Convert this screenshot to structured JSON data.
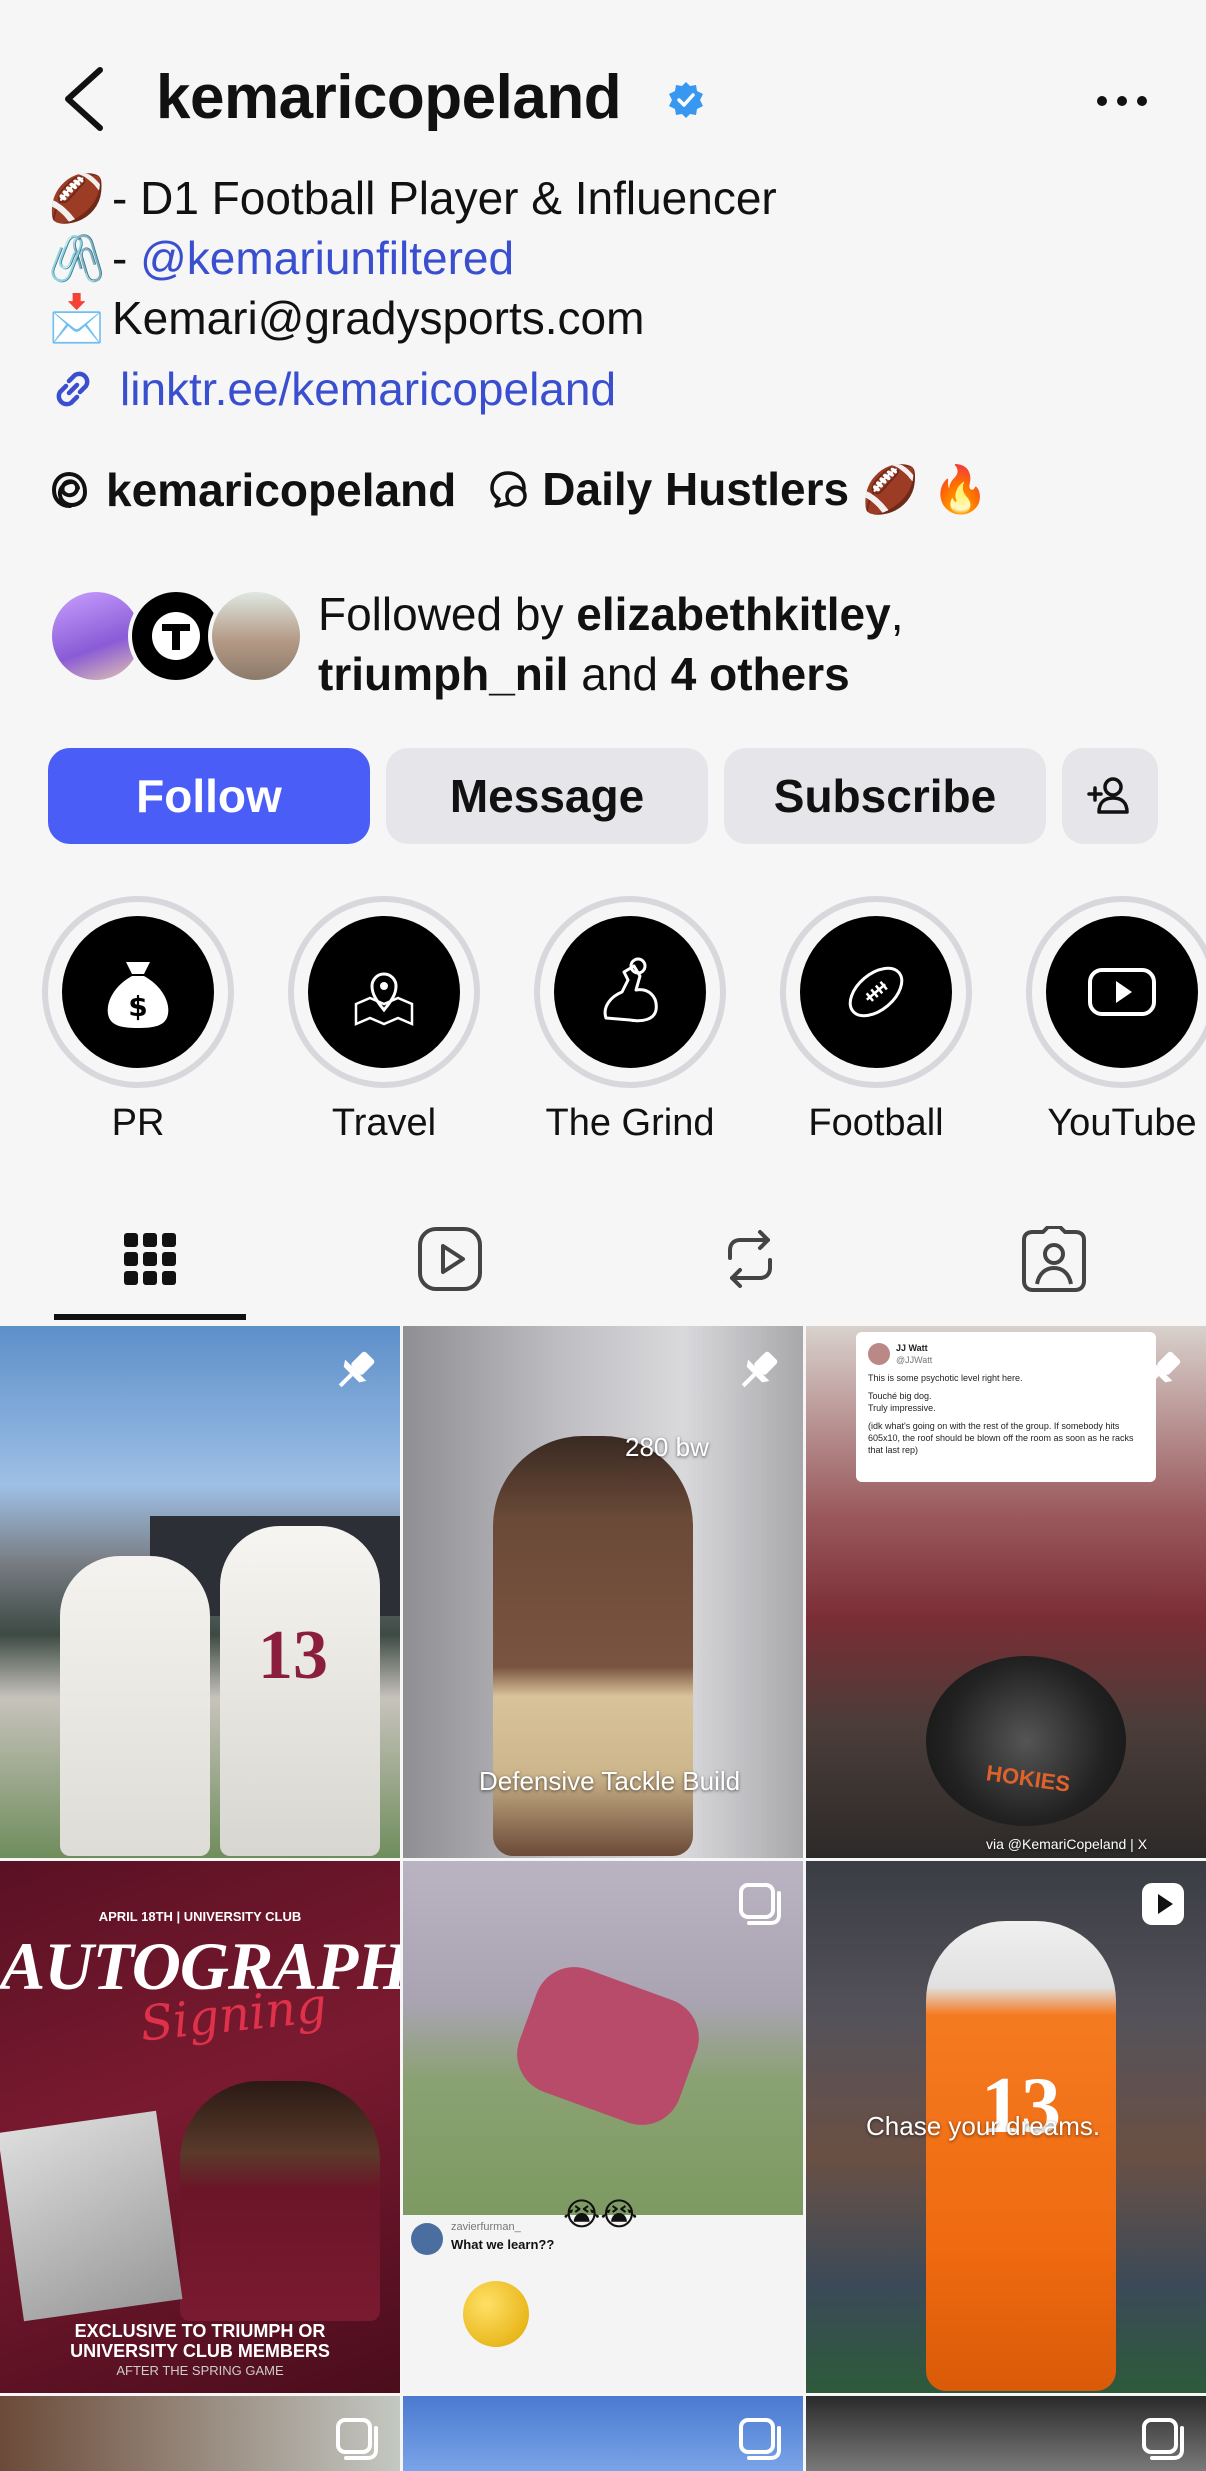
{
  "header": {
    "username": "kemaricopeland",
    "verified_color": "#3897f0"
  },
  "bio": {
    "line1_emoji": "🏈",
    "line1_text": "- D1 Football Player & Influencer",
    "line2_emoji": "🖇️",
    "line2_prefix": "-",
    "line2_mention": "@kemariunfiltered",
    "line3_emoji": "📩",
    "line3_text": "Kemari@gradysports.com",
    "link": "linktr.ee/kemaricopeland"
  },
  "threads": {
    "handle": "kemaricopeland",
    "channel": "Daily Hustlers 🏈 🔥"
  },
  "followed_by": {
    "prefix": "Followed by",
    "user1": "elizabethkitley",
    "separator": ",",
    "user2": "triumph_nil",
    "and": "and",
    "others": "4 others"
  },
  "buttons": {
    "follow": "Follow",
    "message": "Message",
    "subscribe": "Subscribe"
  },
  "highlights": [
    {
      "label": "PR",
      "icon": "money-bag-icon"
    },
    {
      "label": "Travel",
      "icon": "map-pin-icon"
    },
    {
      "label": "The Grind",
      "icon": "flexed-arm-icon"
    },
    {
      "label": "Football",
      "icon": "football-icon"
    },
    {
      "label": "YouTube",
      "icon": "play-icon"
    }
  ],
  "tabs": [
    "grid-icon",
    "reels-icon",
    "reposts-icon",
    "tagged-icon"
  ],
  "posts": [
    {
      "caption": "",
      "pinned": true
    },
    {
      "caption_top": "280 bw",
      "caption_bottom": "Defensive Tackle Build",
      "pinned": true
    },
    {
      "tweet_author": "JJ Watt",
      "tweet_handle": "@JJWatt",
      "tweet_text": "This is some psychotic level right here.",
      "tweet_text2": "Touché big dog.",
      "tweet_text3": "Truly impressive.",
      "tweet_text4": "(idk what's going on with the rest of the group. If somebody hits 605x10, the roof should be blown off the room as soon as he racks that last rep)",
      "credit": "via @KemariCopeland | X",
      "plate_text": "HOKIES",
      "pinned": true
    },
    {
      "top_line": "APRIL 18TH | UNIVERSITY CLUB",
      "title": "AUTOGRAPH",
      "subtitle": "Signing",
      "bottom1": "EXCLUSIVE TO TRIUMPH OR",
      "bottom2": "UNIVERSITY CLUB MEMBERS",
      "bottom3": "AFTER THE SPRING GAME"
    },
    {
      "comment_user": "zavierfurman_",
      "comment_text": "What we learn??",
      "emoji": "😭😭"
    },
    {
      "caption": "Chase your dreams."
    }
  ]
}
